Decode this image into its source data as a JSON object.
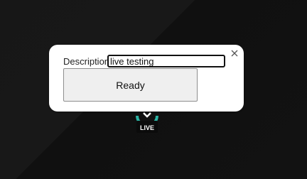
{
  "popup": {
    "description_label": "Description",
    "description_value": "live testing ",
    "ready_label": "Ready",
    "close_icon": "close-icon"
  },
  "live_badge": {
    "text": "LIVE",
    "icon": "live-broadcast-icon",
    "accent_color": "#2bb3a3"
  }
}
